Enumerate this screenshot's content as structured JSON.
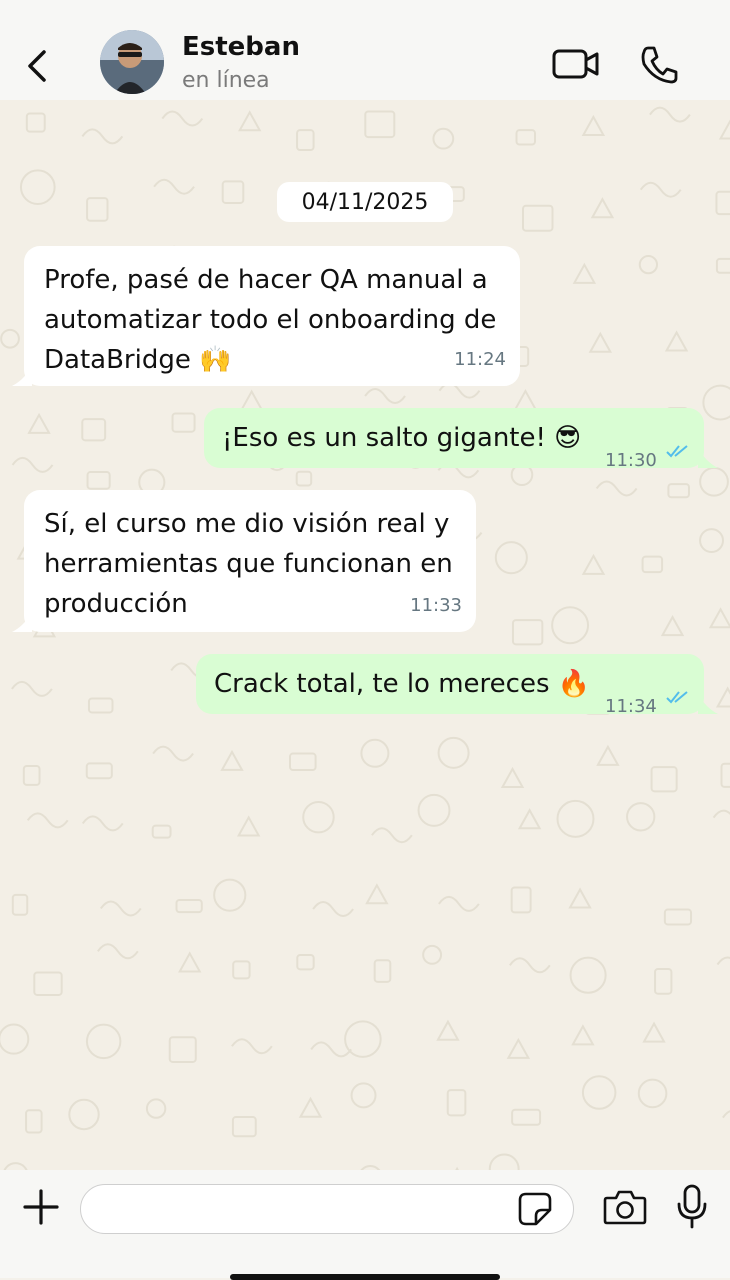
{
  "header": {
    "back_icon": "chevron-left-icon",
    "contact_name": "Esteban",
    "contact_status": "en línea",
    "video_icon": "video-camera-icon",
    "call_icon": "phone-icon"
  },
  "chat": {
    "date_label": "04/11/2025",
    "messages": [
      {
        "direction": "incoming",
        "text": "Profe, pasé de hacer QA manual a\nautomatizar todo el onboarding de\nDataBridge 🙌",
        "time": "11:24"
      },
      {
        "direction": "outgoing",
        "text": "¡Eso es un salto gigante! 😎",
        "time": "11:30",
        "status": "read"
      },
      {
        "direction": "incoming",
        "text": "Sí, el curso me dio visión real y\nherramientas que funcionan en\nproducción",
        "time": "11:33"
      },
      {
        "direction": "outgoing",
        "text": "Crack total, te lo mereces 🔥",
        "time": "11:34",
        "status": "read"
      }
    ]
  },
  "composer": {
    "input_value": "",
    "icons": [
      "plus-icon",
      "sticker-icon",
      "camera-icon",
      "microphone-icon"
    ]
  },
  "colors": {
    "chat_background": "#f3efe6",
    "incoming_bubble": "#ffffff",
    "outgoing_bubble": "#d9fdd3",
    "read_ticks": "#53bdeb"
  }
}
